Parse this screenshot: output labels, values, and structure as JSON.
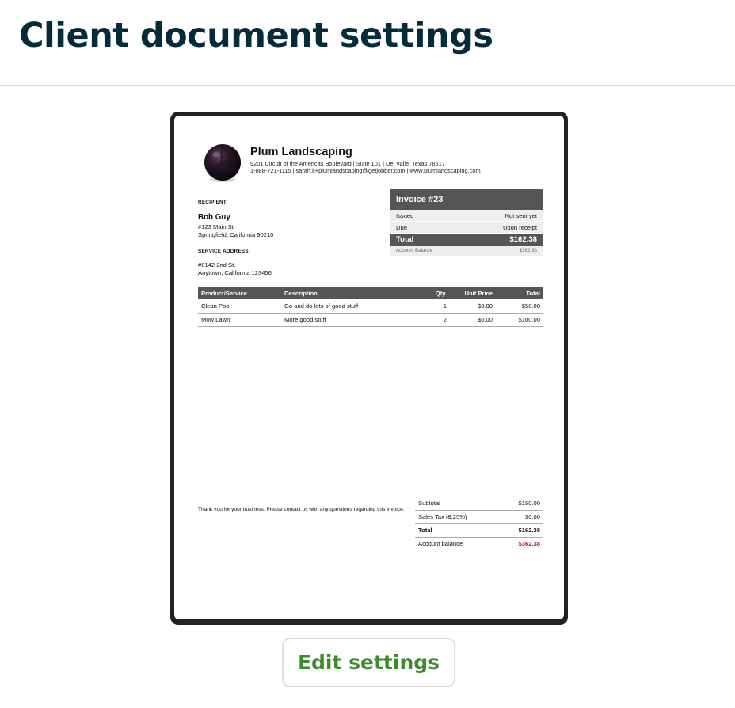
{
  "page": {
    "title": "Client document settings"
  },
  "document": {
    "company": {
      "name": "Plum Landscaping",
      "address_line": "9201 Circuit of the Americas Boulevard  |  Suite 101  |  Del Valle, Texas 78617",
      "contact_line": "1-888-721-1115  |  sarah.k+plumlandscaping@getjobber.com  |  www.plumlandscaping.com",
      "logo_icon": "plum-fruit-icon"
    },
    "recipient": {
      "label": "RECIPIENT:",
      "name": "Bob Guy",
      "street": "#123 Main St.",
      "city": "Springfield, California 90210"
    },
    "service_address": {
      "label": "SERVICE ADDRESS:",
      "street": "#8142 2nd St.",
      "city": "Anytown, California 123456"
    },
    "invoice": {
      "title": "Invoice #23",
      "issued_label": "Issued",
      "issued_value": "Not sent yet",
      "due_label": "Due",
      "due_value": "Upon receipt",
      "total_label": "Total",
      "total_value": "$162.38",
      "balance_label": "Account Balance",
      "balance_value": "$362.38"
    },
    "line_items": {
      "headers": {
        "product": "Product/Service",
        "description": "Description",
        "qty": "Qty.",
        "unit_price": "Unit Price",
        "total": "Total"
      },
      "rows": [
        {
          "product": "Clean Pool",
          "description": "Go and do lots of good stuff",
          "qty": "1",
          "unit_price": "$0.00",
          "total": "$50.00"
        },
        {
          "product": "Mow Lawn",
          "description": "More good stuff",
          "qty": "2",
          "unit_price": "$0.00",
          "total": "$100.00"
        }
      ]
    },
    "thanks_note": "Thank you for your business. Please contact us with any questions regarding this invoice.",
    "totals": {
      "subtotal_label": "Subtotal",
      "subtotal_value": "$150.00",
      "tax_label": "Sales Tax (8.25%)",
      "tax_value": "$0.00",
      "total_label": "Total",
      "total_value": "$162.38",
      "balance_label": "Account balance",
      "balance_value": "$362.38"
    }
  },
  "actions": {
    "edit_label": "Edit settings"
  },
  "colors": {
    "title": "#032b3a",
    "accent_green": "#3f8a2b",
    "balance_red": "#c81414",
    "table_header": "#555555"
  }
}
